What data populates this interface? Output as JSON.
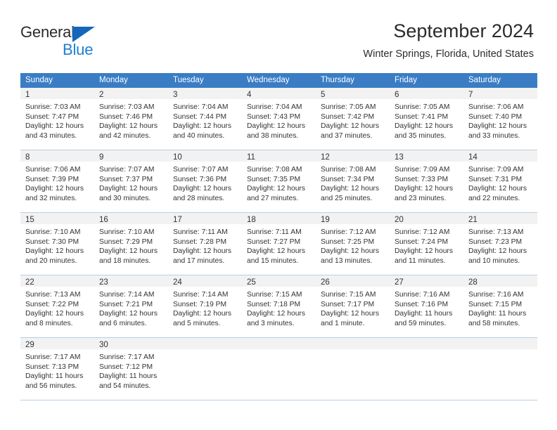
{
  "brand": {
    "name_top": "General",
    "name_bottom": "Blue",
    "accent_color": "#1666ba",
    "blue_text_color": "#1a7fd4"
  },
  "header": {
    "title": "September 2024",
    "subtitle": "Winter Springs, Florida, United States"
  },
  "calendar": {
    "header_bg": "#3a7dc4",
    "day_band_bg": "#f2f2f2",
    "grid_line_color": "#b9cfe4",
    "weekdays": [
      "Sunday",
      "Monday",
      "Tuesday",
      "Wednesday",
      "Thursday",
      "Friday",
      "Saturday"
    ],
    "weeks": [
      [
        {
          "day": "1",
          "sunrise": "Sunrise: 7:03 AM",
          "sunset": "Sunset: 7:47 PM",
          "daylight_1": "Daylight: 12 hours",
          "daylight_2": "and 43 minutes."
        },
        {
          "day": "2",
          "sunrise": "Sunrise: 7:03 AM",
          "sunset": "Sunset: 7:46 PM",
          "daylight_1": "Daylight: 12 hours",
          "daylight_2": "and 42 minutes."
        },
        {
          "day": "3",
          "sunrise": "Sunrise: 7:04 AM",
          "sunset": "Sunset: 7:44 PM",
          "daylight_1": "Daylight: 12 hours",
          "daylight_2": "and 40 minutes."
        },
        {
          "day": "4",
          "sunrise": "Sunrise: 7:04 AM",
          "sunset": "Sunset: 7:43 PM",
          "daylight_1": "Daylight: 12 hours",
          "daylight_2": "and 38 minutes."
        },
        {
          "day": "5",
          "sunrise": "Sunrise: 7:05 AM",
          "sunset": "Sunset: 7:42 PM",
          "daylight_1": "Daylight: 12 hours",
          "daylight_2": "and 37 minutes."
        },
        {
          "day": "6",
          "sunrise": "Sunrise: 7:05 AM",
          "sunset": "Sunset: 7:41 PM",
          "daylight_1": "Daylight: 12 hours",
          "daylight_2": "and 35 minutes."
        },
        {
          "day": "7",
          "sunrise": "Sunrise: 7:06 AM",
          "sunset": "Sunset: 7:40 PM",
          "daylight_1": "Daylight: 12 hours",
          "daylight_2": "and 33 minutes."
        }
      ],
      [
        {
          "day": "8",
          "sunrise": "Sunrise: 7:06 AM",
          "sunset": "Sunset: 7:39 PM",
          "daylight_1": "Daylight: 12 hours",
          "daylight_2": "and 32 minutes."
        },
        {
          "day": "9",
          "sunrise": "Sunrise: 7:07 AM",
          "sunset": "Sunset: 7:37 PM",
          "daylight_1": "Daylight: 12 hours",
          "daylight_2": "and 30 minutes."
        },
        {
          "day": "10",
          "sunrise": "Sunrise: 7:07 AM",
          "sunset": "Sunset: 7:36 PM",
          "daylight_1": "Daylight: 12 hours",
          "daylight_2": "and 28 minutes."
        },
        {
          "day": "11",
          "sunrise": "Sunrise: 7:08 AM",
          "sunset": "Sunset: 7:35 PM",
          "daylight_1": "Daylight: 12 hours",
          "daylight_2": "and 27 minutes."
        },
        {
          "day": "12",
          "sunrise": "Sunrise: 7:08 AM",
          "sunset": "Sunset: 7:34 PM",
          "daylight_1": "Daylight: 12 hours",
          "daylight_2": "and 25 minutes."
        },
        {
          "day": "13",
          "sunrise": "Sunrise: 7:09 AM",
          "sunset": "Sunset: 7:33 PM",
          "daylight_1": "Daylight: 12 hours",
          "daylight_2": "and 23 minutes."
        },
        {
          "day": "14",
          "sunrise": "Sunrise: 7:09 AM",
          "sunset": "Sunset: 7:31 PM",
          "daylight_1": "Daylight: 12 hours",
          "daylight_2": "and 22 minutes."
        }
      ],
      [
        {
          "day": "15",
          "sunrise": "Sunrise: 7:10 AM",
          "sunset": "Sunset: 7:30 PM",
          "daylight_1": "Daylight: 12 hours",
          "daylight_2": "and 20 minutes."
        },
        {
          "day": "16",
          "sunrise": "Sunrise: 7:10 AM",
          "sunset": "Sunset: 7:29 PM",
          "daylight_1": "Daylight: 12 hours",
          "daylight_2": "and 18 minutes."
        },
        {
          "day": "17",
          "sunrise": "Sunrise: 7:11 AM",
          "sunset": "Sunset: 7:28 PM",
          "daylight_1": "Daylight: 12 hours",
          "daylight_2": "and 17 minutes."
        },
        {
          "day": "18",
          "sunrise": "Sunrise: 7:11 AM",
          "sunset": "Sunset: 7:27 PM",
          "daylight_1": "Daylight: 12 hours",
          "daylight_2": "and 15 minutes."
        },
        {
          "day": "19",
          "sunrise": "Sunrise: 7:12 AM",
          "sunset": "Sunset: 7:25 PM",
          "daylight_1": "Daylight: 12 hours",
          "daylight_2": "and 13 minutes."
        },
        {
          "day": "20",
          "sunrise": "Sunrise: 7:12 AM",
          "sunset": "Sunset: 7:24 PM",
          "daylight_1": "Daylight: 12 hours",
          "daylight_2": "and 11 minutes."
        },
        {
          "day": "21",
          "sunrise": "Sunrise: 7:13 AM",
          "sunset": "Sunset: 7:23 PM",
          "daylight_1": "Daylight: 12 hours",
          "daylight_2": "and 10 minutes."
        }
      ],
      [
        {
          "day": "22",
          "sunrise": "Sunrise: 7:13 AM",
          "sunset": "Sunset: 7:22 PM",
          "daylight_1": "Daylight: 12 hours",
          "daylight_2": "and 8 minutes."
        },
        {
          "day": "23",
          "sunrise": "Sunrise: 7:14 AM",
          "sunset": "Sunset: 7:21 PM",
          "daylight_1": "Daylight: 12 hours",
          "daylight_2": "and 6 minutes."
        },
        {
          "day": "24",
          "sunrise": "Sunrise: 7:14 AM",
          "sunset": "Sunset: 7:19 PM",
          "daylight_1": "Daylight: 12 hours",
          "daylight_2": "and 5 minutes."
        },
        {
          "day": "25",
          "sunrise": "Sunrise: 7:15 AM",
          "sunset": "Sunset: 7:18 PM",
          "daylight_1": "Daylight: 12 hours",
          "daylight_2": "and 3 minutes."
        },
        {
          "day": "26",
          "sunrise": "Sunrise: 7:15 AM",
          "sunset": "Sunset: 7:17 PM",
          "daylight_1": "Daylight: 12 hours",
          "daylight_2": "and 1 minute."
        },
        {
          "day": "27",
          "sunrise": "Sunrise: 7:16 AM",
          "sunset": "Sunset: 7:16 PM",
          "daylight_1": "Daylight: 11 hours",
          "daylight_2": "and 59 minutes."
        },
        {
          "day": "28",
          "sunrise": "Sunrise: 7:16 AM",
          "sunset": "Sunset: 7:15 PM",
          "daylight_1": "Daylight: 11 hours",
          "daylight_2": "and 58 minutes."
        }
      ],
      [
        {
          "day": "29",
          "sunrise": "Sunrise: 7:17 AM",
          "sunset": "Sunset: 7:13 PM",
          "daylight_1": "Daylight: 11 hours",
          "daylight_2": "and 56 minutes."
        },
        {
          "day": "30",
          "sunrise": "Sunrise: 7:17 AM",
          "sunset": "Sunset: 7:12 PM",
          "daylight_1": "Daylight: 11 hours",
          "daylight_2": "and 54 minutes."
        },
        {
          "day": "",
          "sunrise": "",
          "sunset": "",
          "daylight_1": "",
          "daylight_2": ""
        },
        {
          "day": "",
          "sunrise": "",
          "sunset": "",
          "daylight_1": "",
          "daylight_2": ""
        },
        {
          "day": "",
          "sunrise": "",
          "sunset": "",
          "daylight_1": "",
          "daylight_2": ""
        },
        {
          "day": "",
          "sunrise": "",
          "sunset": "",
          "daylight_1": "",
          "daylight_2": ""
        },
        {
          "day": "",
          "sunrise": "",
          "sunset": "",
          "daylight_1": "",
          "daylight_2": ""
        }
      ]
    ]
  }
}
